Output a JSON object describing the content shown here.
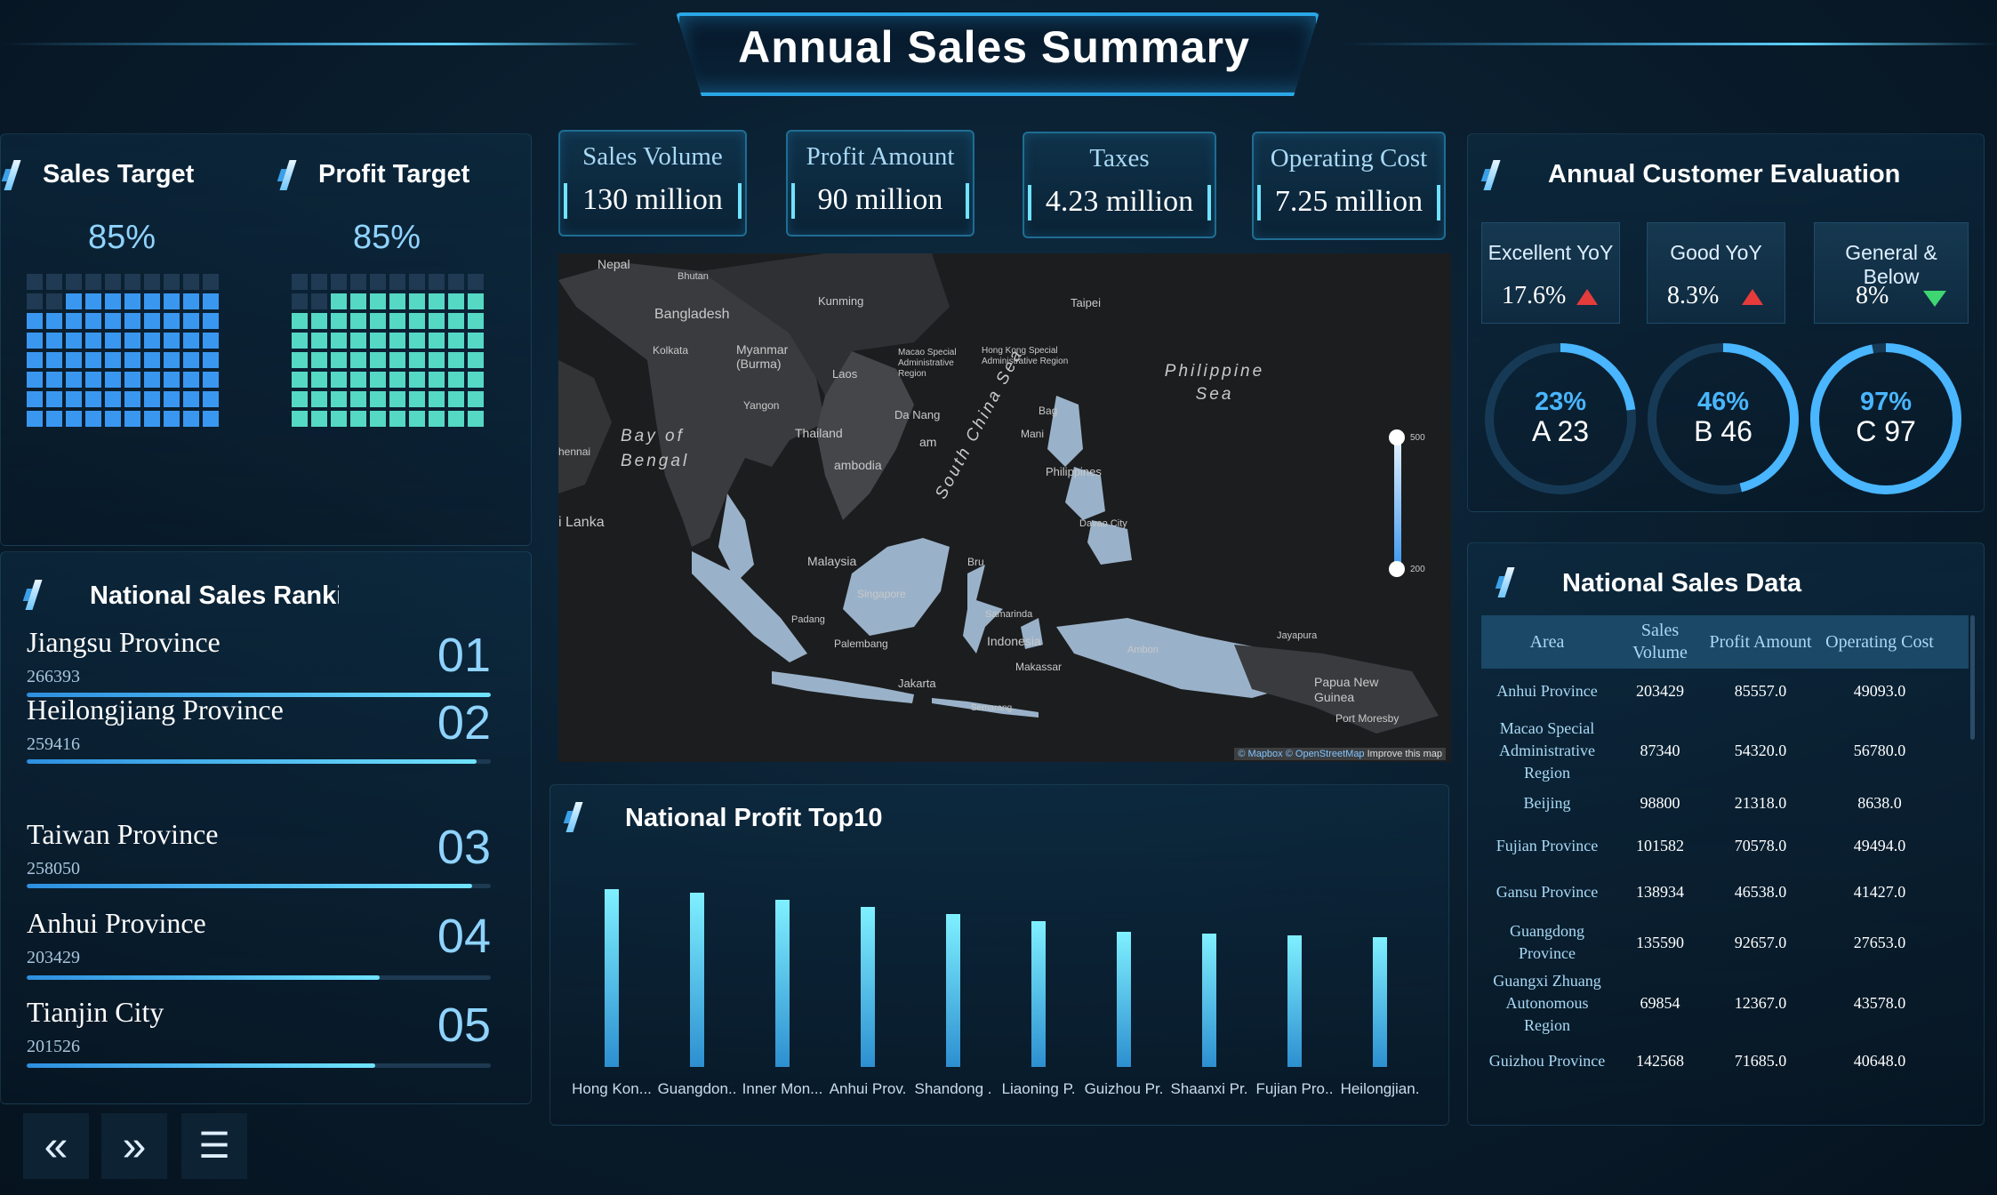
{
  "header": {
    "title": "Annual Sales Summary"
  },
  "targets": {
    "sales": {
      "label": "Sales Target",
      "percent_text": "85%",
      "fraction": 0.85,
      "color": "#3a97f0"
    },
    "profit": {
      "label": "Profit Target",
      "percent_text": "85%",
      "fraction": 0.85,
      "color": "#55d8c4"
    }
  },
  "ranking": {
    "title": "National Sales Ranki",
    "items": [
      {
        "name": "Jiangsu Province",
        "value": "266393",
        "rank": "01",
        "fraction": 1.0
      },
      {
        "name": "Heilongjiang Province",
        "value": "259416",
        "rank": "02",
        "fraction": 0.97
      },
      {
        "name": "Taiwan Province",
        "value": "258050",
        "rank": "03",
        "fraction": 0.96
      },
      {
        "name": "Anhui Province",
        "value": "203429",
        "rank": "04",
        "fraction": 0.76
      },
      {
        "name": "Tianjin City",
        "value": "201526",
        "rank": "05",
        "fraction": 0.75
      }
    ]
  },
  "nav": {
    "prev": "«",
    "next": "»",
    "menu": "☰"
  },
  "kpis": [
    {
      "label": "Sales Volume",
      "value": "130 million"
    },
    {
      "label": "Profit Amount",
      "value": "90 million"
    },
    {
      "label": "Taxes",
      "value": "4.23 million"
    },
    {
      "label": "Operating Cost",
      "value": "7.25 million"
    }
  ],
  "map": {
    "labels": {
      "nepal": "Nepal",
      "bhutan": "Bhutan",
      "bangladesh": "Bangladesh",
      "kolkata": "Kolkata",
      "myanmar": "Myanmar (Burma)",
      "kunming": "Kunming",
      "taipei": "Taipei",
      "macao": "Macao Special Administrative Region",
      "hongkong": "Hong Kong Special Administrative Region",
      "philippine_sea": "Philippine Sea",
      "bay": "Bay of Bengal",
      "chennai": "hennai",
      "laos": "Laos",
      "yangon": "Yangon",
      "thailand": "Thailand",
      "danang": "Da Nang",
      "vietnam": "am",
      "cambodia": "ambodia",
      "scs": "South China Sea",
      "manila": "Mani",
      "baguio": "Bag",
      "philippines": "Philippines",
      "davao": "Davao City",
      "srilanka": "i Lanka",
      "malaysia": "Malaysia",
      "singapore": "Singapore",
      "padang": "Padang",
      "palembang": "Palembang",
      "jakarta": "Jakarta",
      "samarinda": "Samarinda",
      "indonesia": "Indonesia",
      "makassar": "Makassar",
      "jayapura": "Jayapura",
      "png": "Papua New Guinea",
      "portmoresby": "Port Moresby",
      "brunei": "Bru",
      "semarang": "Semarang",
      "ambon": "Ambon"
    },
    "slider": {
      "max_label": "500",
      "min_label": "200"
    },
    "attribution": {
      "mapbox": "© Mapbox",
      "osm": "© OpenStreetMap",
      "improve": "Improve this map"
    }
  },
  "profit_top10": {
    "title": "National Profit Top10"
  },
  "chart_data": {
    "type": "bar",
    "title": "National Profit Top10",
    "categories": [
      "Hong Kon...",
      "Guangdon..",
      "Inner Mon...",
      "Anhui Prov.",
      "Shandong .",
      "Liaoning P.",
      "Guizhou Pr.",
      "Shaanxi Pr.",
      "Fujian Pro..",
      "Heilongjian."
    ],
    "values": [
      100,
      98,
      94,
      90,
      86,
      82,
      76,
      75,
      74,
      73
    ],
    "ylim": [
      0,
      100
    ],
    "color": "#6fe3ff",
    "grid": false
  },
  "evaluation": {
    "title": "Annual Customer Evaluation",
    "boxes": [
      {
        "label": "Excellent YoY",
        "value": "17.6%",
        "trend": "up"
      },
      {
        "label": "Good YoY",
        "value": "8.3%",
        "trend": "up"
      },
      {
        "label": "General & Below",
        "value": "8%",
        "trend": "down"
      }
    ],
    "donuts": [
      {
        "percent_text": "23%",
        "grade": "A 23",
        "fraction": 0.23
      },
      {
        "percent_text": "46%",
        "grade": "B 46",
        "fraction": 0.46
      },
      {
        "percent_text": "97%",
        "grade": "C 97",
        "fraction": 0.97
      }
    ]
  },
  "sales_table": {
    "title": "National Sales Data",
    "columns": [
      "Area",
      "Sales Volume",
      "Profit Amount",
      "Operating Cost"
    ],
    "rows": [
      [
        "Anhui Province",
        "203429",
        "85557.0",
        "49093.0"
      ],
      [
        "Macao Special Administrative Region",
        "87340",
        "54320.0",
        "56780.0"
      ],
      [
        "Beijing",
        "98800",
        "21318.0",
        "8638.0"
      ],
      [
        "Fujian Province",
        "101582",
        "70578.0",
        "49494.0"
      ],
      [
        "Gansu Province",
        "138934",
        "46538.0",
        "41427.0"
      ],
      [
        "Guangdong Province",
        "135590",
        "92657.0",
        "27653.0"
      ],
      [
        "Guangxi Zhuang Autonomous Region",
        "69854",
        "12367.0",
        "43578.0"
      ],
      [
        "Guizhou Province",
        "142568",
        "71685.0",
        "40648.0"
      ]
    ]
  }
}
